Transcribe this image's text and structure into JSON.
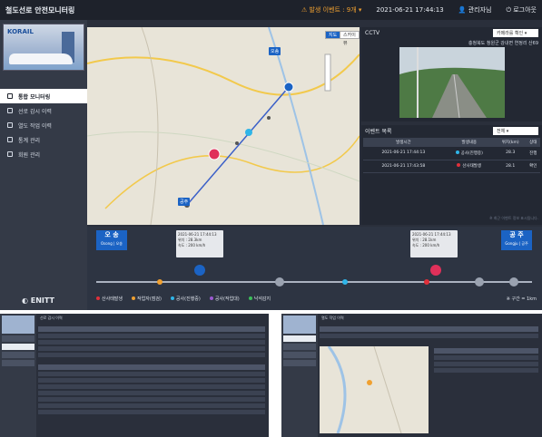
{
  "app": {
    "title": "철도선로 안전모니터링",
    "alert": "발생 이벤트 : 9개",
    "datetime": "2021-06-21 17:44:13",
    "user": "관리자님",
    "logout": "로그아웃"
  },
  "sidebar": {
    "brand": "KORAIL",
    "items": [
      {
        "label": "통합 모니터링",
        "icon": "monitor-icon",
        "active": true
      },
      {
        "label": "선로 감시 이력",
        "icon": "list-icon",
        "active": false
      },
      {
        "label": "열도 작업 이력",
        "icon": "list-icon",
        "active": false
      },
      {
        "label": "통계 관리",
        "icon": "chart-icon",
        "active": false
      },
      {
        "label": "회원 관리",
        "icon": "user-icon",
        "active": false
      }
    ],
    "footer_logo": "ENITT"
  },
  "map": {
    "buttons": [
      "지도",
      "스카이뷰"
    ],
    "labels": [
      "오송",
      "공주"
    ]
  },
  "cctv": {
    "title": "CCTV",
    "select": "카메라를 확인",
    "camera_label": "충청북도 청원군 강내면 연정리 산69"
  },
  "events": {
    "title": "이벤트 목록",
    "filter": "전체",
    "columns": [
      "발생시간",
      "발생내용",
      "위치(km)",
      "상태"
    ],
    "rows": [
      {
        "time": "2021-06-21 17:44:13",
        "type": "공사(진행중)",
        "color": "#2fb5e8",
        "pos": "28.3",
        "status": "진행"
      },
      {
        "time": "2021-06-21 17:43:58",
        "type": "산사태발생",
        "color": "#e0303a",
        "pos": "28.1",
        "status": "확인"
      }
    ],
    "note": "※ 최근 이벤트 정보 표시됩니다."
  },
  "track": {
    "start": {
      "name": "오 송",
      "sub": "Osong | 오송"
    },
    "end": {
      "name": "공 주",
      "sub": "Gongju | 공주"
    },
    "popup_left": {
      "time": "2021-06-21 17:44:13",
      "l1": "위치 : 28.3km",
      "l2": "속도 : 200 km/h"
    },
    "popup_right": {
      "time": "2021-06-21 17:44:13",
      "l1": "위치 : 28.1km",
      "l2": "속도 : 200 km/h"
    },
    "legend": [
      {
        "label": "산사태발생",
        "color": "#e0303a"
      },
      {
        "label": "작업자(점검)",
        "color": "#f0a030"
      },
      {
        "label": "공사(진행중)",
        "color": "#2fb5e8"
      },
      {
        "label": "공사(작업대)",
        "color": "#9b59d0"
      },
      {
        "label": "낙석감지",
        "color": "#3cbf5a"
      }
    ],
    "scale": "※ 구간 = 1km"
  },
  "sub_screens": [
    {
      "title": "선로 감시 이력"
    },
    {
      "title": "열도 작업 이력"
    }
  ]
}
